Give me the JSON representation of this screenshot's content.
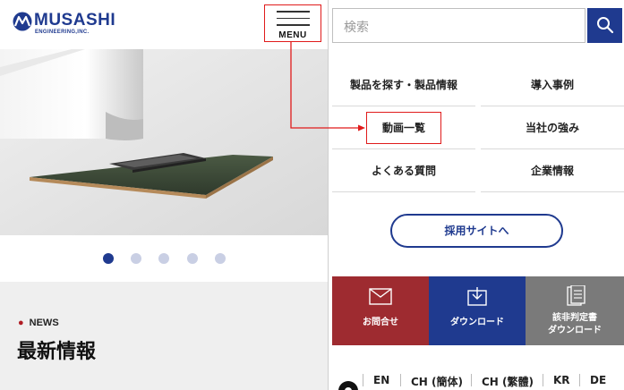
{
  "brand": {
    "name": "MUSASHI",
    "sub": "ENGINEERING,INC.",
    "color": "#1f3a8f"
  },
  "menu_button": {
    "label": "MENU",
    "highlight_color": "#e01b1b"
  },
  "carousel": {
    "slides": 5,
    "active_index": 0
  },
  "news": {
    "tag": "NEWS",
    "title": "最新情報"
  },
  "search": {
    "placeholder": "検索",
    "icon": "search-icon"
  },
  "nav": {
    "items": [
      {
        "label": "製品を探す・製品情報"
      },
      {
        "label": "導入事例"
      },
      {
        "label": "動画一覧"
      },
      {
        "label": "当社の強み"
      },
      {
        "label": "よくある質問"
      },
      {
        "label": "企業情報"
      }
    ]
  },
  "recruit": {
    "label": "採用サイトへ"
  },
  "actions": {
    "contact": {
      "label": "お問合せ",
      "icon": "mail-icon",
      "color": "#9e2b30"
    },
    "download": {
      "label": "ダウンロード",
      "icon": "download-icon",
      "color": "#1f3a8f"
    },
    "judge": {
      "line1": "該非判定書",
      "line2": "ダウンロード",
      "icon": "document-icon",
      "color": "#7a7a7a"
    }
  },
  "languages": [
    "EN",
    "CH (簡体)",
    "CH (繁體)",
    "KR",
    "DE"
  ]
}
